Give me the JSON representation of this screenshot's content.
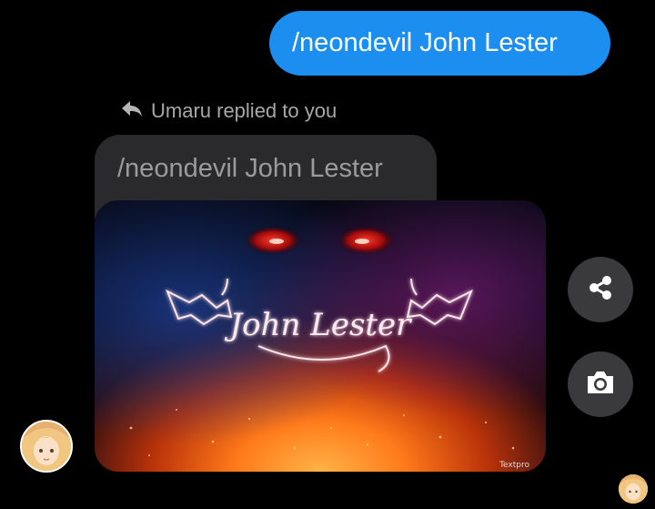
{
  "sent_message": {
    "text": "/neondevil John Lester"
  },
  "reply_indicator": {
    "text": "Umaru replied to you",
    "icon": "reply-arrow-icon"
  },
  "quoted_message": {
    "text": "/neondevil John Lester"
  },
  "image_card": {
    "caption_text": "John Lester",
    "watermark": "Textpro"
  },
  "actions": {
    "share_icon": "share-icon",
    "camera_icon": "camera-icon"
  },
  "colors": {
    "background": "#000000",
    "sent_bubble": "#1c8ef0",
    "received_bubble": "#2a2a2c",
    "action_button": "#3a3a3c"
  }
}
